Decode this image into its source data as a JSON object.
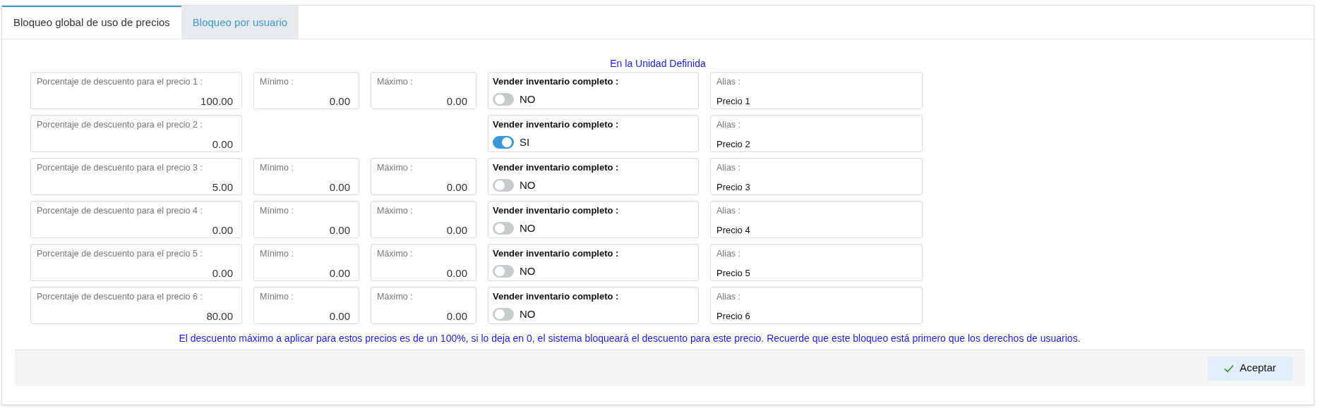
{
  "tabs": [
    {
      "label": "Bloqueo global de uso de precios",
      "selected": true
    },
    {
      "label": "Bloqueo por usuario",
      "selected": false
    }
  ],
  "section_title": "En la Unidad Definida",
  "rows": [
    {
      "discount_label": "Porcentaje de descuento para el precio 1 :",
      "discount": "100.00",
      "min_label": "Mínimo :",
      "min": "0.00",
      "max_label": "Máximo :",
      "max": "0.00",
      "toggle_label": "Vender inventario completo :",
      "sell_full_inventory": false,
      "toggle_text": "NO",
      "alias_label": "Alias :",
      "alias": "Precio 1"
    },
    {
      "discount_label": "Porcentaje de descuento para el precio 2 :",
      "discount": "0.00",
      "toggle_label": "Vender inventario completo :",
      "sell_full_inventory": true,
      "toggle_text": "SI",
      "alias_label": "Alias :",
      "alias": "Precio 2"
    },
    {
      "discount_label": "Porcentaje de descuento para el precio 3 :",
      "discount": "5.00",
      "min_label": "Mínimo :",
      "min": "0.00",
      "max_label": "Máximo :",
      "max": "0.00",
      "toggle_label": "Vender inventario completo :",
      "sell_full_inventory": false,
      "toggle_text": "NO",
      "alias_label": "Alias :",
      "alias": "Precio 3"
    },
    {
      "discount_label": "Porcentaje de descuento para el precio 4 :",
      "discount": "0.00",
      "min_label": "Mínimo :",
      "min": "0.00",
      "max_label": "Máximo :",
      "max": "0.00",
      "toggle_label": "Vender inventario completo :",
      "sell_full_inventory": false,
      "toggle_text": "NO",
      "alias_label": "Alias :",
      "alias": "Precio 4"
    },
    {
      "discount_label": "Porcentaje de descuento para el precio 5 :",
      "discount": "0.00",
      "min_label": "Mínimo :",
      "min": "0.00",
      "max_label": "Máximo :",
      "max": "0.00",
      "toggle_label": "Vender inventario completo :",
      "sell_full_inventory": false,
      "toggle_text": "NO",
      "alias_label": "Alias :",
      "alias": "Precio 5"
    },
    {
      "discount_label": "Porcentaje de descuento para el precio 6 :",
      "discount": "80.00",
      "min_label": "Mínimo :",
      "min": "0.00",
      "max_label": "Máximo :",
      "max": "0.00",
      "toggle_label": "Vender inventario completo :",
      "sell_full_inventory": false,
      "toggle_text": "NO",
      "alias_label": "Alias :",
      "alias": "Precio 6"
    }
  ],
  "note": "El descuento máximo a aplicar para estos precios es de un 100%, si lo deja en 0, el sistema bloqueará el descuento para este precio. Recuerde que este bloqueo está primero que los derechos de usuarios.",
  "accept_button": "Aceptar"
}
